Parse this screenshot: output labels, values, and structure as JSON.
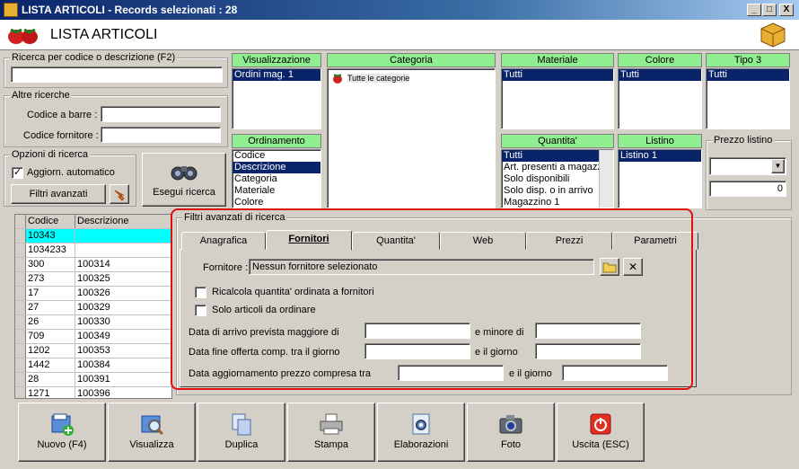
{
  "window": {
    "title": "LISTA ARTICOLI - Records selezionati : 28",
    "min": "_",
    "max": "□",
    "close": "X"
  },
  "header": {
    "title": "LISTA ARTICOLI"
  },
  "search": {
    "legend": "Ricerca per codice o descrizione (F2)",
    "value": ""
  },
  "other": {
    "legend": "Altre ricerche",
    "barcode_label": "Codice a barre :",
    "supplier_label": "Codice fornitore :"
  },
  "options": {
    "legend": "Opzioni di ricerca",
    "auto_label": "Aggiorn. automatico",
    "auto_checked": "✓",
    "adv_btn": "Filtri avanzati"
  },
  "exec_btn": "Esegui ricerca",
  "visual": {
    "header": "Visualizzazione",
    "items": [
      "Ordini mag. 1"
    ]
  },
  "ordering": {
    "header": "Ordinamento",
    "items": [
      "Codice",
      "Descrizione",
      "Categoria",
      "Materiale",
      "Colore"
    ]
  },
  "category": {
    "header": "Categoria",
    "items": [
      "Tutte le categorie"
    ]
  },
  "material": {
    "header": "Materiale",
    "items": [
      "Tutti"
    ]
  },
  "color": {
    "header": "Colore",
    "items": [
      "Tutti"
    ]
  },
  "tipo3": {
    "header": "Tipo 3",
    "items": [
      "Tutti"
    ]
  },
  "quantity": {
    "header": "Quantita'",
    "items": [
      "Tutti",
      "Art. presenti a magazzi",
      "Solo disponibili",
      "Solo disp. o in arrivo",
      "Magazzino 1"
    ]
  },
  "listino": {
    "header": "Listino",
    "items": [
      "Listino 1"
    ]
  },
  "price": {
    "legend": "Prezzo listino",
    "value": "0"
  },
  "grid": {
    "headers": [
      "Codice",
      "Descrizione"
    ],
    "rows": [
      [
        "10343",
        ""
      ],
      [
        "1034233",
        ""
      ],
      [
        "300",
        "100314"
      ],
      [
        "273",
        "100325"
      ],
      [
        "17",
        "100326"
      ],
      [
        "27",
        "100329"
      ],
      [
        "26",
        "100330"
      ],
      [
        "709",
        "100349"
      ],
      [
        "1202",
        "100353"
      ],
      [
        "1442",
        "100384"
      ],
      [
        "28",
        "100391"
      ],
      [
        "1271",
        "100396"
      ]
    ]
  },
  "adv": {
    "legend": "Filtri avanzati di ricerca",
    "tabs": [
      "Anagrafica",
      "Fornitori",
      "Quantita'",
      "Web",
      "Prezzi",
      "Parametri"
    ],
    "supplier_label": "Fornitore :",
    "supplier_value": "Nessun fornitore selezionato",
    "chk1": "Ricalcola quantita' ordinata a fornitori",
    "chk2": "Solo articoli da ordinare",
    "arrival_label": "Data di arrivo prevista maggiore di",
    "arrival_to": "e minore di",
    "offer_label": "Data fine offerta comp. tra il giorno",
    "offer_to": "e il giorno",
    "update_label": "Data aggiornamento prezzo compresa tra",
    "update_to": "e il giorno"
  },
  "toolbar": [
    "Nuovo (F4)",
    "Visualizza",
    "Duplica",
    "Stampa",
    "Elaborazioni",
    "Foto",
    "Uscita (ESC)"
  ]
}
